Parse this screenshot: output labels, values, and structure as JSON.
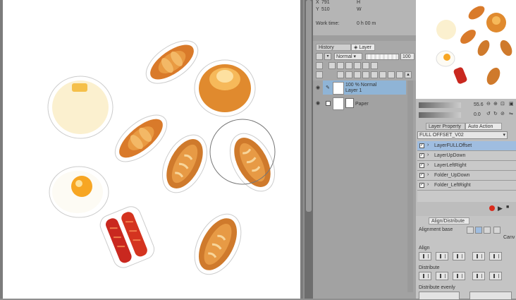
{
  "info": {
    "x_value": "791",
    "y_value": "510",
    "w_label": "W",
    "h_label": "H",
    "work_time_label": "Work time:",
    "work_time_value": "0 h 00 m"
  },
  "layer_panel": {
    "tab_history": "History",
    "tab_layer": "Layer",
    "blend_mode": "Normal",
    "opacity": "100",
    "layers": [
      {
        "line1": "100 % Normal",
        "line2": "Layer 1"
      },
      {
        "line1": "",
        "line2": "Paper"
      }
    ]
  },
  "navigator": {
    "zoom": "55.6",
    "angle": "0.0"
  },
  "auto_action": {
    "tab_layer_property": "Layer Property",
    "tab_auto_action": "Auto Action",
    "set_name": "FULL OFFSET_V02",
    "items": [
      "LayerFULLOffset",
      "LayerUpDown",
      "LayerLeftRight",
      "Folder_UpDown",
      "Folder_LeftRight"
    ]
  },
  "align_panel": {
    "title": "Align/Distribute",
    "alignment_base_label": "Alignment base",
    "canvas_label": "Canv",
    "align_label": "Align",
    "distribute_label": "Distribute",
    "distribute_evenly_label": "Distribute evenly"
  },
  "colors": {
    "accent_selection": "#8fb4d6",
    "record": "#d92b1c"
  }
}
